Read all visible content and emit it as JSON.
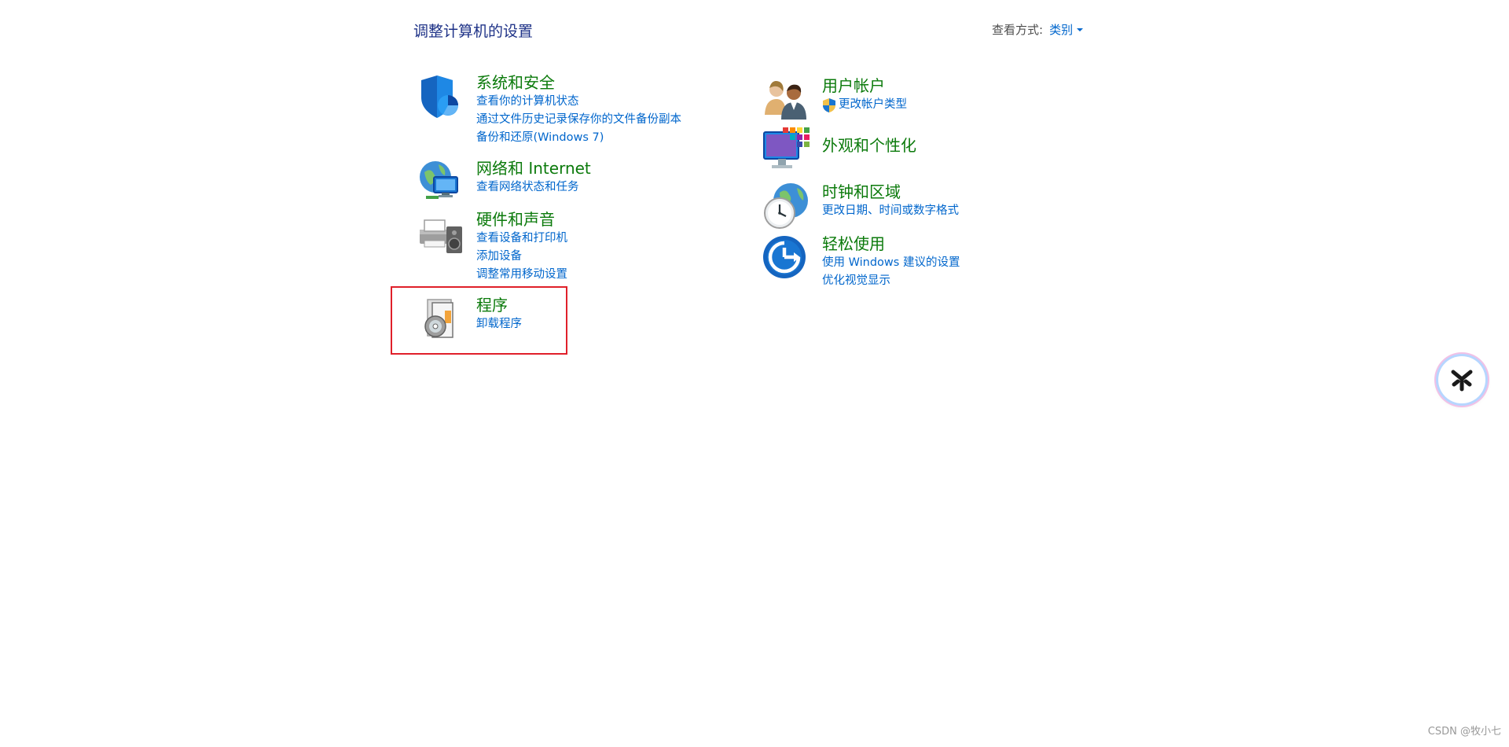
{
  "header": {
    "title": "调整计算机的设置",
    "view_by_label": "查看方式:",
    "view_by_value": "类别"
  },
  "categories": {
    "system_security": {
      "title": "系统和安全",
      "icon": "shield-icon",
      "links": [
        "查看你的计算机状态",
        "通过文件历史记录保存你的文件备份副本",
        "备份和还原(Windows 7)"
      ]
    },
    "network": {
      "title": "网络和 Internet",
      "icon": "network-globe-icon",
      "links": [
        "查看网络状态和任务"
      ]
    },
    "hardware_sound": {
      "title": "硬件和声音",
      "icon": "printer-speaker-icon",
      "links": [
        "查看设备和打印机",
        "添加设备",
        "调整常用移动设置"
      ]
    },
    "programs": {
      "title": "程序",
      "icon": "programs-disc-icon",
      "links": [
        "卸载程序"
      ]
    },
    "user_accounts": {
      "title": "用户帐户",
      "icon": "users-icon",
      "links": [
        "更改帐户类型"
      ]
    },
    "appearance": {
      "title": "外观和个性化",
      "icon": "display-palette-icon",
      "links": []
    },
    "clock_region": {
      "title": "时钟和区域",
      "icon": "clock-globe-icon",
      "links": [
        "更改日期、时间或数字格式"
      ]
    },
    "ease_of_access": {
      "title": "轻松使用",
      "icon": "ease-of-access-icon",
      "links": [
        "使用 Windows 建议的设置",
        "优化视觉显示"
      ]
    }
  },
  "watermark": "CSDN @牧小七",
  "colors": {
    "category_title": "#0b7a0b",
    "link": "#0066cc",
    "page_title": "#1e3287",
    "highlight_box": "#e0202a"
  }
}
